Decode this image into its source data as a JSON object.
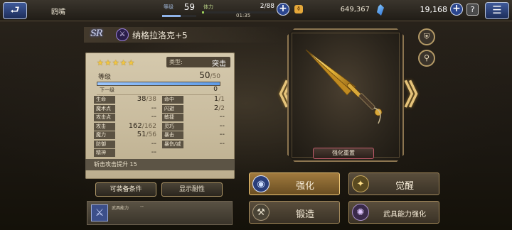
{
  "topbar": {
    "player_name": "鸥嘴",
    "level_label": "等级",
    "level_value": "59",
    "level_progress": 0.55,
    "stamina_label": "体力",
    "stamina_value": "2/88",
    "stamina_timer": "01:35",
    "stamina_progress": 0.03,
    "gil_icon": "⚱",
    "gil_value": "649,367",
    "gem_value": "19,168",
    "help_label": "?",
    "menu_icon": "☰",
    "back_icon": "⮐"
  },
  "equipment": {
    "rarity": "SR",
    "type_icon": "⚔",
    "name": "纳格拉洛克+5",
    "stars": "★★★★★",
    "kind_label": "类型:",
    "kind_value": "突击",
    "level_label": "等级",
    "level_value": "50",
    "level_max": "/50",
    "level_progress": 1.0,
    "next_label": "下一级",
    "next_value": "0",
    "stats": [
      {
        "label": "生命",
        "value": "38",
        "max": "/38"
      },
      {
        "label": "命中",
        "value": "1",
        "max": "/1"
      },
      {
        "label": "魔术点",
        "value": "--",
        "max": ""
      },
      {
        "label": "闪避",
        "value": "2",
        "max": "/2"
      },
      {
        "label": "攻击点",
        "value": "--",
        "max": ""
      },
      {
        "label": "敏捷",
        "value": "--",
        "max": ""
      },
      {
        "label": "攻击",
        "value": "162",
        "max": "/162"
      },
      {
        "label": "灵巧",
        "value": "--",
        "max": ""
      },
      {
        "label": "魔力",
        "value": "51",
        "max": "/56"
      },
      {
        "label": "暴击",
        "value": "--",
        "max": ""
      },
      {
        "label": "防御",
        "value": "--",
        "max": ""
      },
      {
        "label": "暴伤/减",
        "value": "--",
        "max": ""
      },
      {
        "label": "精神",
        "value": "--",
        "max": ""
      }
    ],
    "effect_text": "斩击攻击提升 15",
    "req_button": "可装备条件",
    "res_button": "显示耐性",
    "ability_label": "武具能力",
    "ability_value": "--"
  },
  "viewer": {
    "reset_button": "强化重置",
    "left_arrow": "《",
    "right_arrow": "》",
    "shield_icon": "⛨",
    "search_icon": "⚲"
  },
  "actions": {
    "enhance": "强化",
    "awaken": "觉醒",
    "forge": "锻造",
    "ability_enhance": "武具能力强化",
    "enhance_icon": "◉",
    "awaken_icon": "✦",
    "forge_icon": "⚒",
    "ability_icon": "✺"
  },
  "colors": {
    "accent_gold": "#e5c37a",
    "parchment": "#d5c9ad",
    "button_blue": "#2b468e",
    "reset_border": "#c05a6a"
  }
}
